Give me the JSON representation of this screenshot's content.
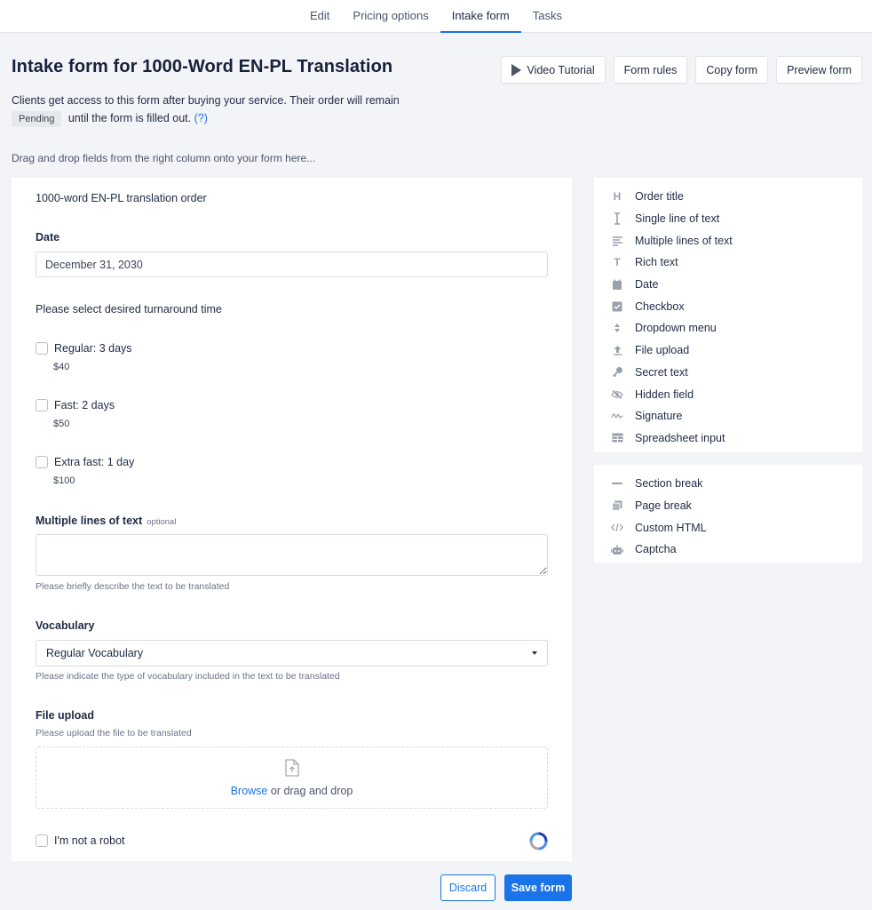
{
  "nav": {
    "tabs": [
      {
        "label": "Edit"
      },
      {
        "label": "Pricing options"
      },
      {
        "label": "Intake form"
      },
      {
        "label": "Tasks"
      }
    ],
    "active": "Intake form"
  },
  "header": {
    "title": "Intake form for 1000-Word EN-PL Translation",
    "buttons": {
      "video": "Video Tutorial",
      "rules": "Form rules",
      "copy": "Copy form",
      "preview": "Preview form"
    },
    "desc_before": "Clients get access to this form after buying your service. Their order will remain",
    "status_badge": "Pending",
    "desc_after": "until the form is filled out.",
    "help_link": "(?)",
    "hint": "Drag and drop fields from the right column onto your form here..."
  },
  "form": {
    "heading": "1000-word EN-PL translation order",
    "date": {
      "label": "Date",
      "value": "December 31, 2030"
    },
    "turnaround": {
      "question": "Please select desired turnaround time",
      "options": [
        {
          "label": "Regular: 3 days",
          "price": "$40"
        },
        {
          "label": "Fast: 2 days",
          "price": "$50"
        },
        {
          "label": "Extra fast: 1 day",
          "price": "$100"
        }
      ]
    },
    "multiline": {
      "label": "Multiple lines of text",
      "optional": "optional",
      "help": "Please briefly describe the text to be translated"
    },
    "vocabulary": {
      "label": "Vocabulary",
      "selected": "Regular Vocabulary",
      "help": "Please indicate the type of vocabulary included in the text to be translated"
    },
    "file_upload": {
      "label": "File upload",
      "help": "Please upload the file to be translated",
      "browse": "Browse",
      "drag_text": "or drag and drop"
    },
    "captcha": {
      "label": "I'm not a robot"
    }
  },
  "palette": {
    "fields": [
      {
        "label": "Order title",
        "icon": "heading-icon"
      },
      {
        "label": "Single line of text",
        "icon": "text-cursor-icon"
      },
      {
        "label": "Multiple lines of text",
        "icon": "lines-icon"
      },
      {
        "label": "Rich text",
        "icon": "rich-text-icon"
      },
      {
        "label": "Date",
        "icon": "calendar-icon"
      },
      {
        "label": "Checkbox",
        "icon": "checkbox-icon"
      },
      {
        "label": "Dropdown menu",
        "icon": "dropdown-icon"
      },
      {
        "label": "File upload",
        "icon": "upload-icon"
      },
      {
        "label": "Secret text",
        "icon": "key-icon"
      },
      {
        "label": "Hidden field",
        "icon": "eye-slash-icon"
      },
      {
        "label": "Signature",
        "icon": "signature-icon"
      },
      {
        "label": "Spreadsheet input",
        "icon": "table-icon"
      }
    ],
    "layout": [
      {
        "label": "Section break",
        "icon": "minus-icon"
      },
      {
        "label": "Page break",
        "icon": "pages-icon"
      },
      {
        "label": "Custom HTML",
        "icon": "code-icon"
      },
      {
        "label": "Captcha",
        "icon": "robot-icon"
      }
    ]
  },
  "footer": {
    "discard": "Discard",
    "save": "Save form"
  },
  "colors": {
    "accent": "#1a73e8",
    "background": "#f3f4f7",
    "text": "#1f2a44"
  }
}
